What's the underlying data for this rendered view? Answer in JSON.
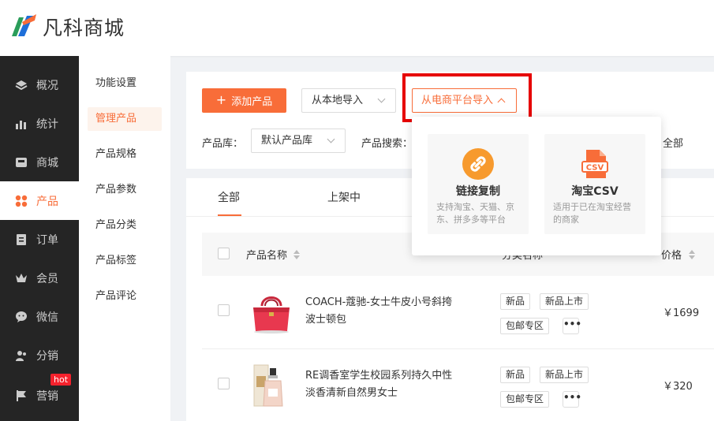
{
  "brand": {
    "name": "凡科商城"
  },
  "sidenav": {
    "items": [
      {
        "label": "概况",
        "icon": "layers-icon"
      },
      {
        "label": "统计",
        "icon": "bar-chart-icon"
      },
      {
        "label": "商城",
        "icon": "store-icon"
      },
      {
        "label": "产品",
        "icon": "product-grid-icon",
        "active": true
      },
      {
        "label": "订单",
        "icon": "order-icon"
      },
      {
        "label": "会员",
        "icon": "crown-icon"
      },
      {
        "label": "微信",
        "icon": "wechat-icon"
      },
      {
        "label": "分销",
        "icon": "distribution-icon"
      },
      {
        "label": "营销",
        "icon": "flag-icon",
        "badge": "hot"
      }
    ]
  },
  "subnav": {
    "items": [
      {
        "label": "功能设置"
      },
      {
        "label": "管理产品",
        "active": true
      },
      {
        "label": "产品规格"
      },
      {
        "label": "产品参数"
      },
      {
        "label": "产品分类"
      },
      {
        "label": "产品标签"
      },
      {
        "label": "产品评论"
      }
    ]
  },
  "toolbar": {
    "add_label": "添加产品",
    "add_icon": "+",
    "local_import_label": "从本地导入",
    "platform_import_label": "从电商平台导入",
    "library_label": "产品库：",
    "library_value": "默认产品库",
    "search_label": "产品搜索：",
    "right_filter_value": "全部"
  },
  "import_popover": {
    "cards": [
      {
        "title": "链接复制",
        "desc": "支持淘宝、天猫、京东、拼多多等平台",
        "icon": "link-icon"
      },
      {
        "title": "淘宝CSV",
        "desc": "适用于已在淘宝经营的商家",
        "icon": "csv-file-icon"
      }
    ]
  },
  "tabs": [
    {
      "label": "全部",
      "active": true
    },
    {
      "label": "上架中"
    }
  ],
  "table": {
    "headers": {
      "name": "产品名称",
      "category": "分类名称",
      "price": "价格"
    },
    "rows": [
      {
        "name": "COACH-蔻驰-女士牛皮小号斜挎波士顿包",
        "tags": [
          "新品",
          "新品上市",
          "包邮专区"
        ],
        "price": "￥1699",
        "image": "red-handbag"
      },
      {
        "name": "RE调香室学生校园系列持久中性淡香清新自然男女士",
        "tags": [
          "新品",
          "新品上市",
          "包邮专区"
        ],
        "price": "￥320",
        "image": "perfume-bottle"
      }
    ],
    "more_label": "•••"
  },
  "colors": {
    "accent": "#f86d39",
    "sidebar": "#252525",
    "highlight": "#e60000"
  }
}
